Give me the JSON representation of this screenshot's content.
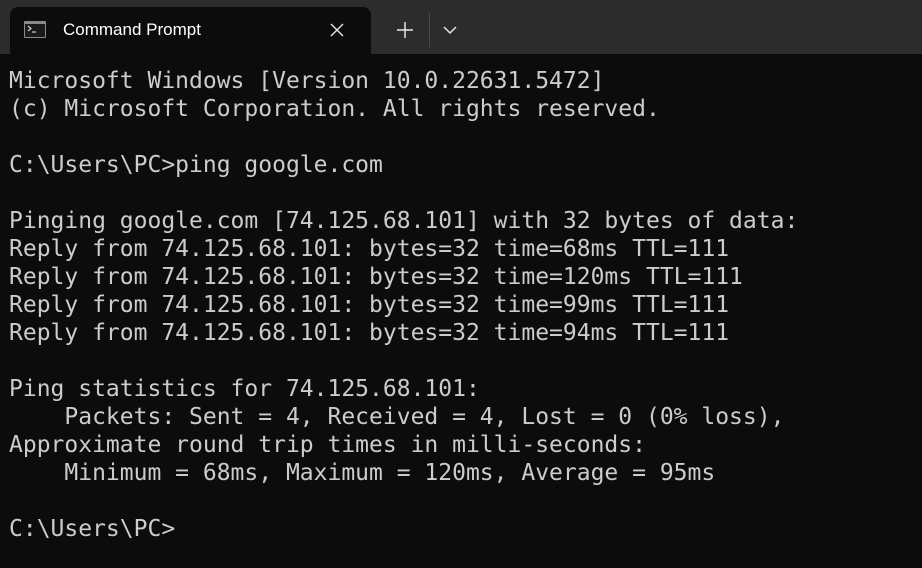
{
  "tab": {
    "title": "Command Prompt",
    "icon": "terminal-icon"
  },
  "titlebar": {
    "close_icon": "close-icon",
    "new_tab_icon": "plus-icon",
    "dropdown_icon": "chevron-down-icon"
  },
  "terminal": {
    "lines": [
      "Microsoft Windows [Version 10.0.22631.5472]",
      "(c) Microsoft Corporation. All rights reserved.",
      "",
      "C:\\Users\\PC>ping google.com",
      "",
      "Pinging google.com [74.125.68.101] with 32 bytes of data:",
      "Reply from 74.125.68.101: bytes=32 time=68ms TTL=111",
      "Reply from 74.125.68.101: bytes=32 time=120ms TTL=111",
      "Reply from 74.125.68.101: bytes=32 time=99ms TTL=111",
      "Reply from 74.125.68.101: bytes=32 time=94ms TTL=111",
      "",
      "Ping statistics for 74.125.68.101:",
      "    Packets: Sent = 4, Received = 4, Lost = 0 (0% loss),",
      "Approximate round trip times in milli-seconds:",
      "    Minimum = 68ms, Maximum = 120ms, Average = 95ms",
      "",
      "C:\\Users\\PC>"
    ]
  },
  "colors": {
    "background": "#0c0c0c",
    "titlebar": "#2c2c2c",
    "text": "#cccccc"
  }
}
